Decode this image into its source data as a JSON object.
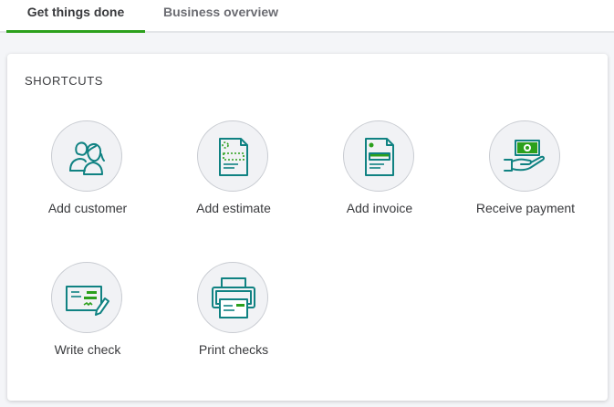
{
  "tabs": {
    "active": "Get things done",
    "inactive": "Business overview"
  },
  "card": {
    "title": "SHORTCUTS"
  },
  "shortcuts": [
    {
      "label": "Add customer",
      "icon": "customers-icon"
    },
    {
      "label": "Add estimate",
      "icon": "estimate-document-icon"
    },
    {
      "label": "Add invoice",
      "icon": "invoice-document-icon"
    },
    {
      "label": "Receive payment",
      "icon": "hand-with-money-icon"
    },
    {
      "label": "Write check",
      "icon": "check-with-pen-icon"
    },
    {
      "label": "Print checks",
      "icon": "printer-icon"
    }
  ],
  "colors": {
    "accent": "#2ca01c",
    "icon_teal": "#108282",
    "text": "#393a3d"
  }
}
